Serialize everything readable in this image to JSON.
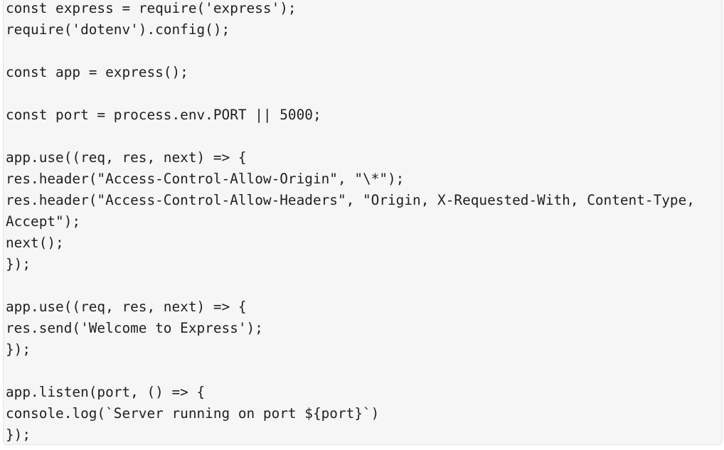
{
  "code_block": {
    "language": "javascript",
    "lines": [
      "const express = require('express');",
      "require('dotenv').config();",
      "",
      "const app = express();",
      "",
      "const port = process.env.PORT || 5000;",
      "",
      "app.use((req, res, next) => {",
      "res.header(\"Access-Control-Allow-Origin\", \"\\*\");",
      "res.header(\"Access-Control-Allow-Headers\", \"Origin, X-Requested-With, Content-Type,",
      "Accept\");",
      "next();",
      "});",
      "",
      "app.use((req, res, next) => {",
      "res.send('Welcome to Express');",
      "});",
      "",
      "app.listen(port, () => {",
      "console.log(`Server running on port ${port}`)",
      "});"
    ]
  }
}
